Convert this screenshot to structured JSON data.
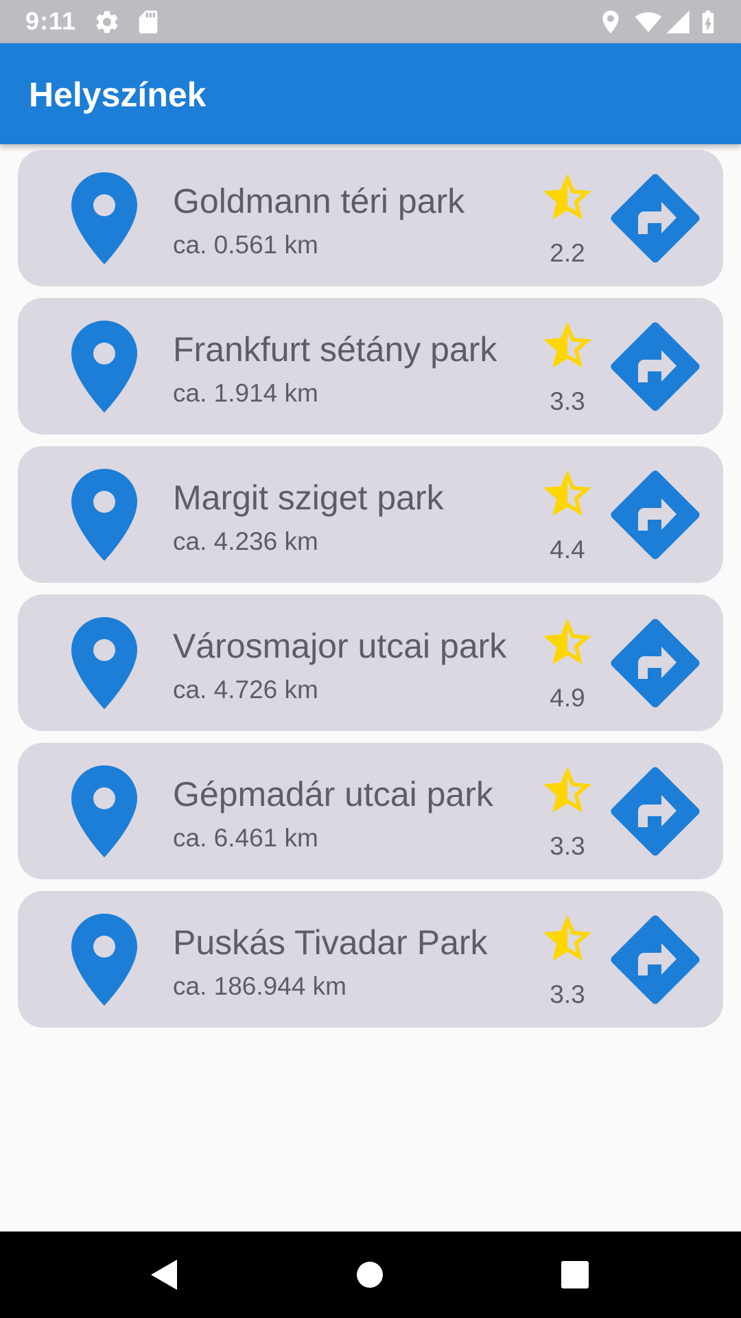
{
  "status_bar": {
    "time": "9:11",
    "icons": [
      "settings-icon",
      "sd-card-icon",
      "location-icon",
      "wifi-icon",
      "signal-icon",
      "battery-charging-icon"
    ]
  },
  "app_bar": {
    "title": "Helyszínek"
  },
  "colors": {
    "primary": "#1c7ed6",
    "card": "#dbd8e1",
    "star": "#ffd600",
    "text": "#5d5d66"
  },
  "places": [
    {
      "name": "Goldmann téri park",
      "distance": "ca. 0.561 km",
      "rating": "2.2"
    },
    {
      "name": "Frankfurt sétány park",
      "distance": "ca. 1.914 km",
      "rating": "3.3"
    },
    {
      "name": "Margit sziget park",
      "distance": "ca. 4.236 km",
      "rating": "4.4"
    },
    {
      "name": "Városmajor utcai park",
      "distance": "ca. 4.726 km",
      "rating": "4.9"
    },
    {
      "name": "Gépmadár utcai park",
      "distance": "ca. 6.461 km",
      "rating": "3.3"
    },
    {
      "name": "Puskás Tivadar Park",
      "distance": "ca. 186.944 km",
      "rating": "3.3"
    }
  ],
  "nav_bar": {
    "buttons": [
      "back-icon",
      "home-icon",
      "recents-icon"
    ]
  }
}
